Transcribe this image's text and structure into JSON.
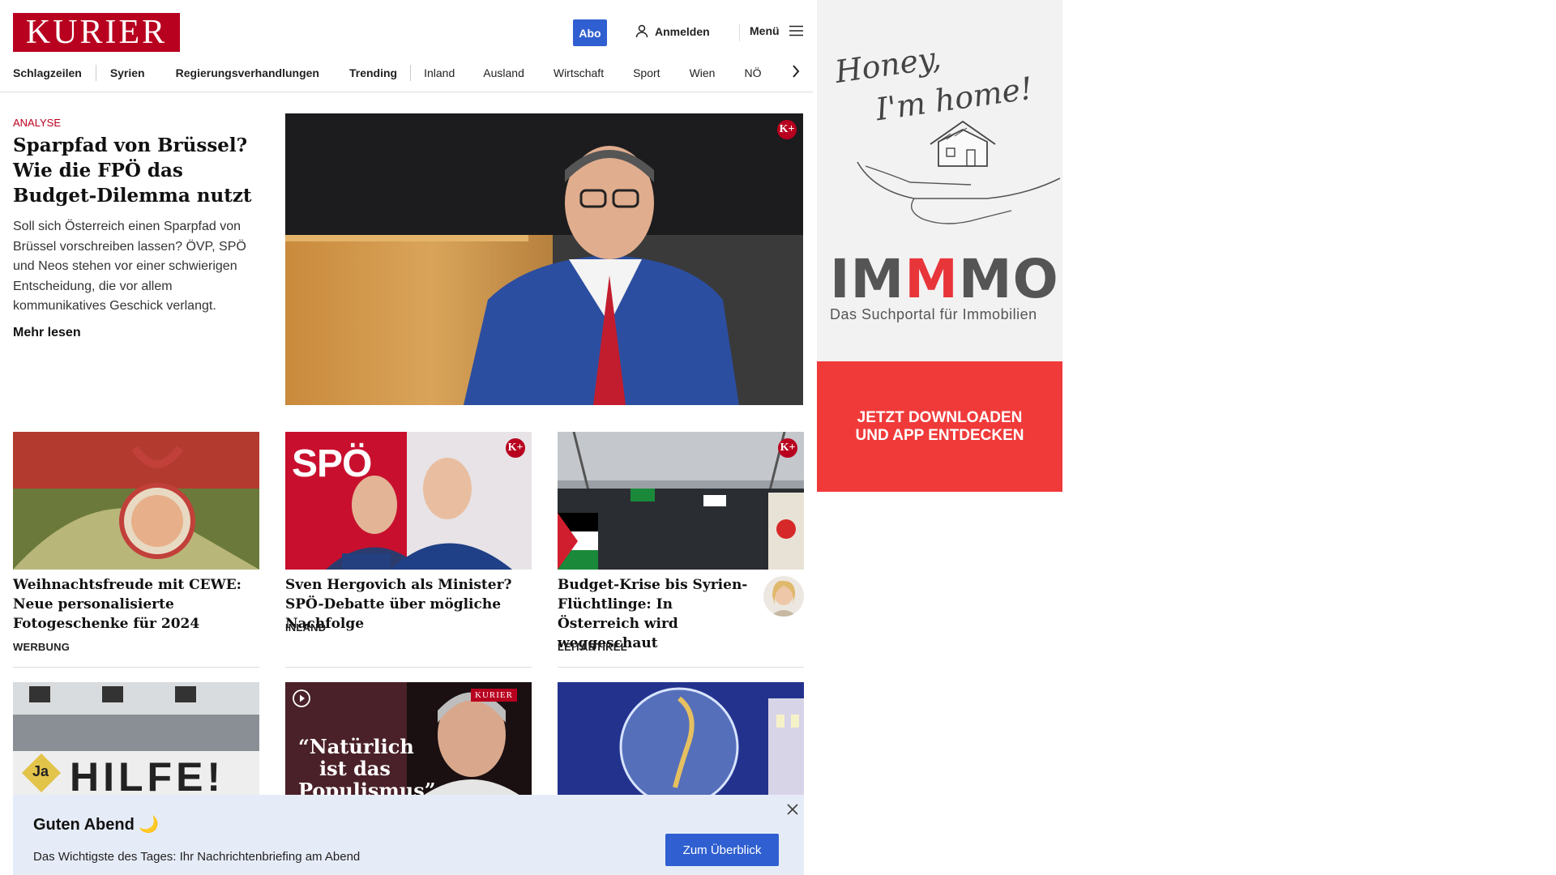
{
  "header": {
    "logo_text": "KURIER",
    "abo_label": "Abo",
    "login_label": "Anmelden",
    "menu_label": "Menü"
  },
  "nav": {
    "items": [
      "Schlagzeilen",
      "Syrien",
      "Regierungsverhandlungen",
      "Trending",
      "Inland",
      "Ausland",
      "Wirtschaft",
      "Sport",
      "Wien",
      "NÖ"
    ]
  },
  "hero": {
    "kicker": "ANALYSE",
    "title": "Sparpfad von Brüssel? Wie die FPÖ das Budget-Dilemma nutzt",
    "teaser": "Soll sich Österreich einen Sparpfad von Brüssel vorschreiben lassen? ÖVP, SPÖ und Neos stehen vor einer schwierigen Entscheidung, die vor allem kommunikatives Geschick verlangt.",
    "more": "Mehr lesen",
    "badge": "K+"
  },
  "cards": [
    {
      "title": "Weihnachtsfreude mit CEWE: Neue personalisierte Fotogeschenke für 2024",
      "category": "WERBUNG"
    },
    {
      "title": "Sven Hergovich als Minister? SPÖ-Debatte über mögliche Nachfolge",
      "category": "INLAND",
      "badge": "K+",
      "image_text": "SPÖ"
    },
    {
      "title": "Budget-Krise bis Syrien-Flüchtlinge: In Österreich wird weggeschaut",
      "category": "LEITARTIKEL",
      "badge": "K+"
    }
  ],
  "row2": {
    "card1_sign": "HILFE!",
    "card1_badge": "Ja",
    "card2_quote": "“Natürlich ist das Populismus”",
    "card2_brand": "KURIER"
  },
  "ad": {
    "script": [
      "Honey,",
      "I'm home!"
    ],
    "brand": "IMMMO",
    "tagline": "Das Suchportal für Immobilien",
    "cta": [
      "JETZT DOWNLOADEN",
      "UND APP ENTDECKEN"
    ]
  },
  "briefing": {
    "title": "Guten Abend 🌙",
    "text": "Das Wichtigste des Tages: Ihr Nachrichtenbriefing am Abend",
    "button": "Zum Überblick"
  },
  "colors": {
    "brand_red": "#b8001f",
    "button_blue": "#2f5fd0",
    "ad_red": "#f03a3a",
    "briefing_bg": "#e6ecf7"
  }
}
